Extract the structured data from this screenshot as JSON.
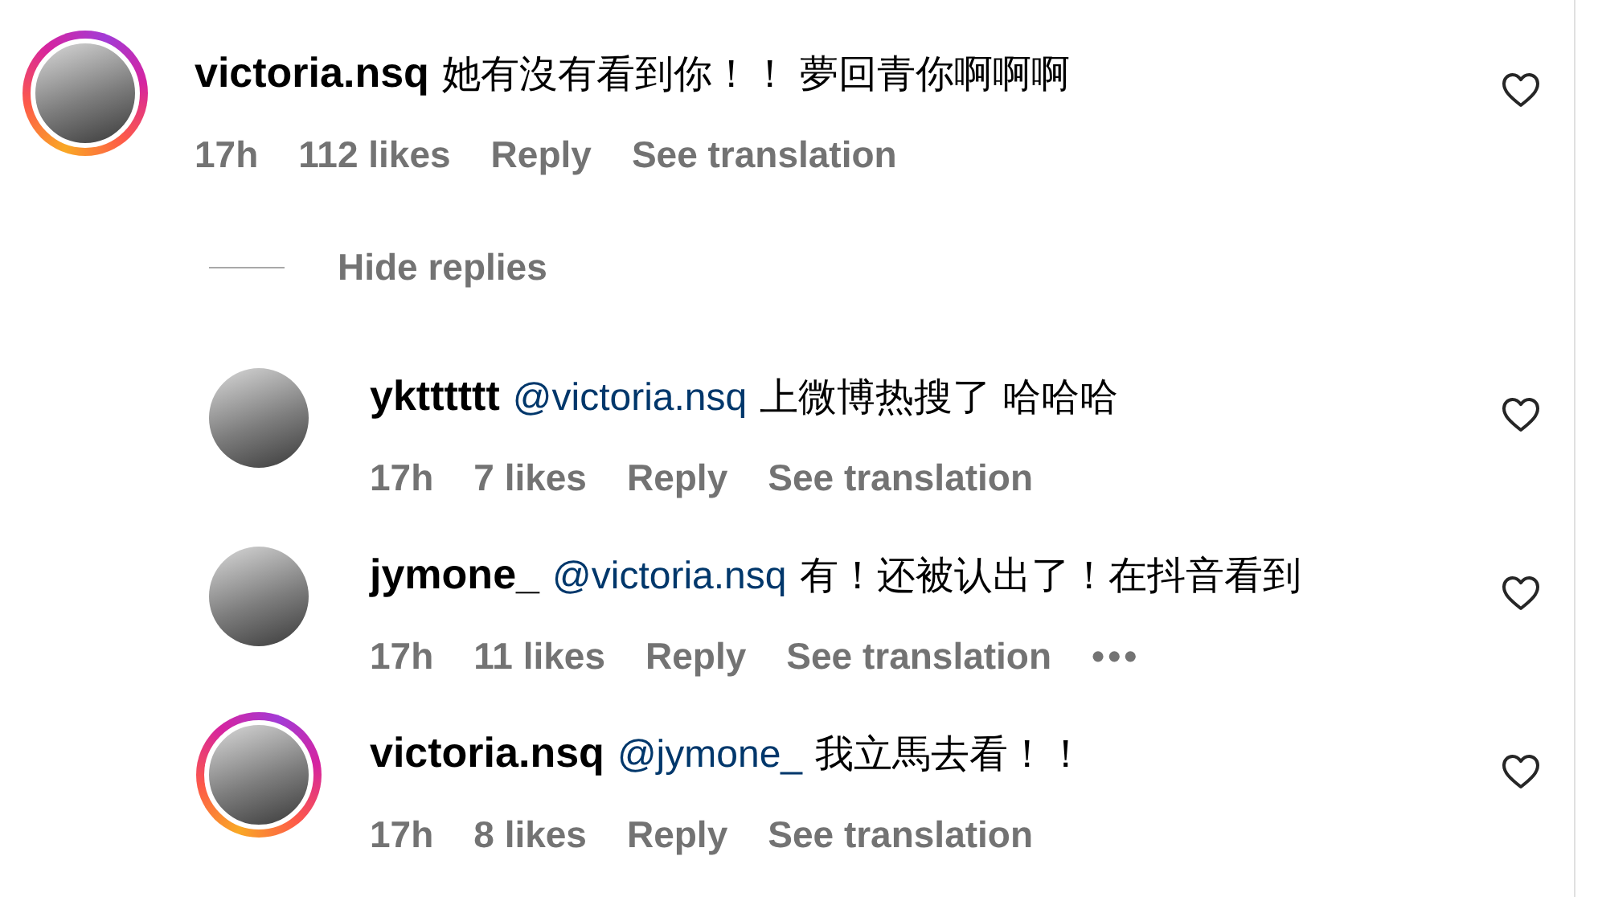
{
  "comment": {
    "username": "victoria.nsq",
    "text": "她有沒有看到你！！ 夢回青你啊啊啊",
    "story_ring": true,
    "time": "17h",
    "likes": "112 likes",
    "reply": "Reply",
    "translation": "See translation"
  },
  "replies_toggle": {
    "label": "Hide replies"
  },
  "replies": [
    {
      "username": "yktttttt",
      "mention": "@victoria.nsq",
      "text": "上微博热搜了 哈哈哈",
      "story_ring": false,
      "time": "17h",
      "likes": "7 likes",
      "reply": "Reply",
      "translation": "See translation"
    },
    {
      "username": "jymone_",
      "mention": "@victoria.nsq",
      "text": "有！还被认出了！在抖音看到",
      "story_ring": false,
      "time": "17h",
      "likes": "11 likes",
      "reply": "Reply",
      "translation": "See translation",
      "more": "•••"
    },
    {
      "username": "victoria.nsq",
      "mention": "@jymone_",
      "text": "我立馬去看！！",
      "story_ring": true,
      "time": "17h",
      "likes": "8 likes",
      "reply": "Reply",
      "translation": "See translation"
    }
  ]
}
